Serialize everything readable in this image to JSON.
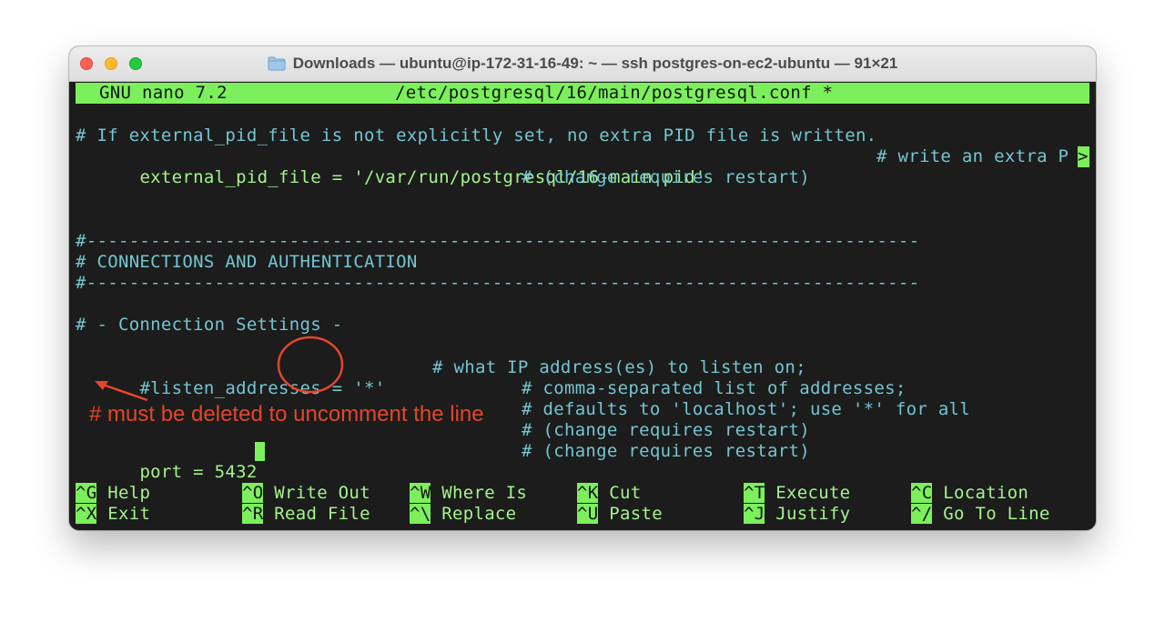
{
  "window": {
    "title": "Downloads — ubuntu@ip-172-31-16-49: ~ — ssh postgres-on-ec2-ubuntu — 91×21"
  },
  "nano": {
    "version": "GNU nano 7.2",
    "filename": "/etc/postgresql/16/main/postgresql.conf *"
  },
  "lines": {
    "l1": "# If external_pid_file is not explicitly set, no extra PID file is written.",
    "l2_a": "external_pid_file = '/var/run/postgresql/16-main.pid'",
    "l2_b": "# write an extra P",
    "l2_overflow": ">",
    "l3": "# (change requires restart)",
    "l6": "#------------------------------------------------------------------------------",
    "l7": "# CONNECTIONS AND AUTHENTICATION",
    "l8": "#------------------------------------------------------------------------------",
    "l10": "# - Connection Settings -",
    "l12_a": "#listen_addresses = '*'",
    "l12_b": "# what IP address(es) to listen on;",
    "l13": "# comma-separated list of addresses;",
    "l14": "# defaults to 'localhost'; use '*' for all",
    "l15": "# (change requires restart)",
    "l16_a": "port = 5432",
    "l16_b": "# (change requires restart)"
  },
  "shortcuts": [
    {
      "key": "^G",
      "label": "Help"
    },
    {
      "key": "^O",
      "label": "Write Out"
    },
    {
      "key": "^W",
      "label": "Where Is"
    },
    {
      "key": "^K",
      "label": "Cut"
    },
    {
      "key": "^T",
      "label": "Execute"
    },
    {
      "key": "^C",
      "label": "Location"
    },
    {
      "key": "^X",
      "label": "Exit"
    },
    {
      "key": "^R",
      "label": "Read File"
    },
    {
      "key": "^\\",
      "label": "Replace"
    },
    {
      "key": "^U",
      "label": "Paste"
    },
    {
      "key": "^J",
      "label": "Justify"
    },
    {
      "key": "^/",
      "label": "Go To Line"
    }
  ],
  "annotation": {
    "text": "# must be deleted to uncomment the line"
  },
  "colors": {
    "terminal_bg": "#1b1c1b",
    "nano_bar": "#7cf05c",
    "comment_text": "#74c5d2",
    "code_text": "#a5f28e",
    "annotation": "#e3462c"
  }
}
